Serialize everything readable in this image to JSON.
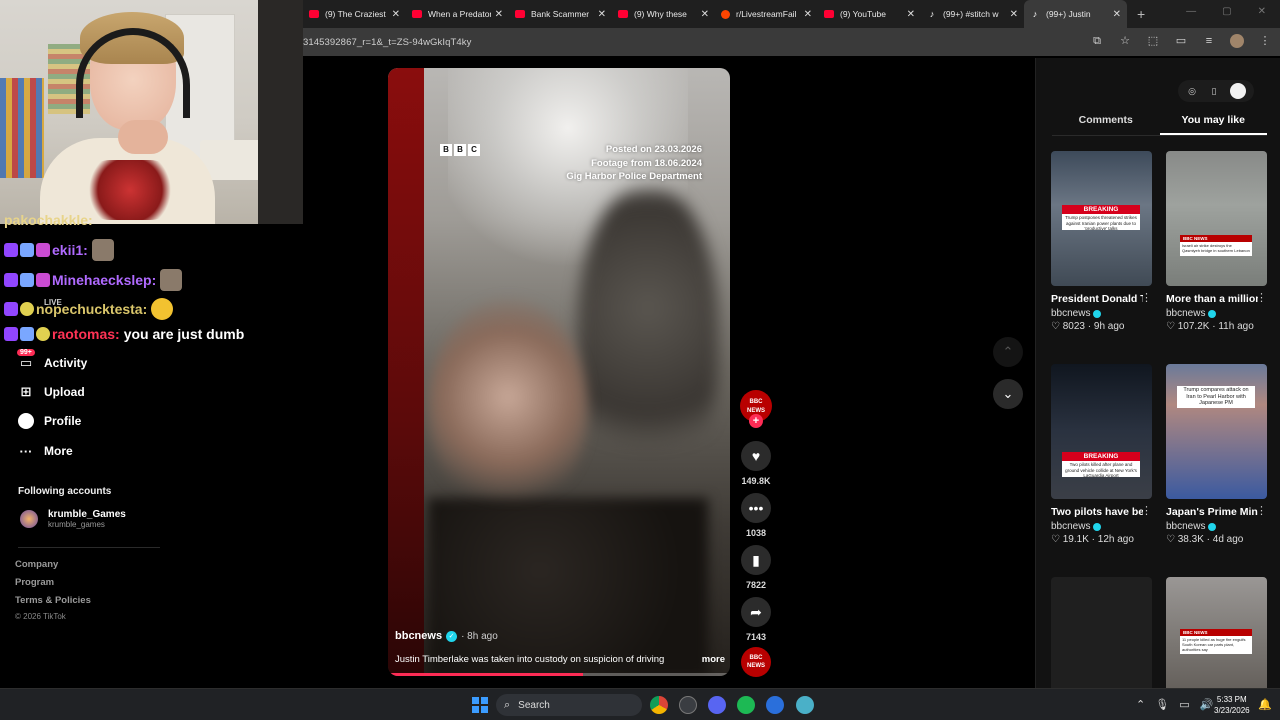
{
  "browser": {
    "tabs": [
      {
        "title": "(9) The Craziest",
        "icon": "youtube-icon"
      },
      {
        "title": "When a Predator",
        "icon": "youtube-icon"
      },
      {
        "title": "Bank Scammer",
        "icon": "youtube-icon"
      },
      {
        "title": "(9) Why these",
        "icon": "youtube-icon"
      },
      {
        "title": "r/LivestreamFail",
        "icon": "reddit-icon"
      },
      {
        "title": "(9) YouTube",
        "icon": "youtube-icon"
      },
      {
        "title": "(99+) #stitch w",
        "icon": "tiktok-icon"
      },
      {
        "title": "(99+) Justin",
        "icon": "tiktok-icon",
        "active": true
      }
    ],
    "new_tab_label": "+",
    "url": "3145392867_r=1&_t=ZS-94wGkIqT4ky"
  },
  "chat": {
    "lines": [
      {
        "user": "pakochakkle:",
        "message": ""
      },
      {
        "user": "ekii1:",
        "message": ""
      },
      {
        "user": "Minehaeckslер:",
        "message": ""
      },
      {
        "user": "nopechucktesta:",
        "message": ""
      },
      {
        "user": "raotomas:",
        "message": "you are just dumb"
      }
    ],
    "live_label": "LIVE"
  },
  "nav": {
    "items": [
      {
        "label": "Activity",
        "icon": "activity-icon",
        "badge": "99+"
      },
      {
        "label": "Upload",
        "icon": "upload-icon"
      },
      {
        "label": "Profile",
        "icon": "profile-icon"
      },
      {
        "label": "More",
        "icon": "more-icon"
      }
    ],
    "following_heading": "Following accounts",
    "following": [
      {
        "name": "krumble_Games",
        "handle": "krumble_games"
      }
    ],
    "footer": [
      "Company",
      "Program",
      "Terms & Policies"
    ],
    "copyright": "© 2026 TikTok"
  },
  "video": {
    "logo": [
      "B",
      "B",
      "C"
    ],
    "posted": "Posted on 23.03.2026",
    "footage": "Footage from 18.06.2024",
    "source": "Gig Harbor Police Department",
    "author": "bbcnews",
    "time": "· 8h ago",
    "description": "Justin Timberlake was taken into custody on suspicion of driving",
    "more_label": "more",
    "progress": 0.57,
    "channel_badge": "BBC NEWS"
  },
  "actions": {
    "likes": "149.8K",
    "comments": "1038",
    "saves": "7822",
    "shares": "7143"
  },
  "panel": {
    "tabs": [
      {
        "label": "Comments"
      },
      {
        "label": "You may like",
        "active": true
      }
    ],
    "cards": [
      {
        "title": "President Donald Trump said the U...",
        "user": "bbcnews",
        "likes": "8023",
        "age": "9h ago",
        "breaking": "BREAKING",
        "headline": "Trump postpones threatened strikes against Iranian power plants due to 'productive' talks"
      },
      {
        "title": "More than a million people...",
        "user": "bbcnews",
        "likes": "107.2K",
        "age": "11h ago",
        "news_tag": "BBC NEWS",
        "headline": "Israeli air strike destroys the Qasmiyeh bridge in southern Lebanon"
      },
      {
        "title": "Two pilots have been killed after...",
        "user": "bbcnews",
        "likes": "19.1K",
        "age": "12h ago",
        "breaking": "BREAKING",
        "headline": "Two pilots killed after plane and ground vehicle collide at New York's LaGuardia Airport"
      },
      {
        "title": "Japan's Prime Minister Sanae...",
        "user": "bbcnews",
        "likes": "38.3K",
        "age": "4d ago",
        "headline": "Trump compares attack on Iran to Pearl Harbor with Japanese PM"
      },
      {
        "title": "",
        "user": "",
        "likes": "",
        "age": ""
      },
      {
        "title": "",
        "user": "",
        "likes": "",
        "age": "",
        "news_tag": "BBC NEWS",
        "headline": "11 people killed as huge fire engulfs South Korean car parts plant, authorities say"
      }
    ]
  },
  "taskbar": {
    "search_label": "Search",
    "time": "5:33 PM",
    "date": "3/23/2026"
  }
}
